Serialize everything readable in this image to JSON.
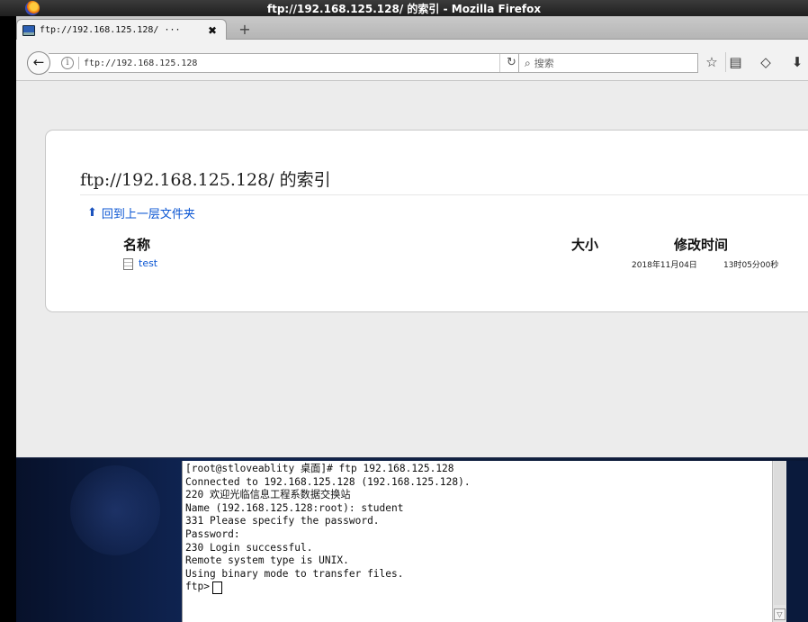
{
  "window": {
    "title": "ftp://192.168.125.128/ 的索引 - Mozilla Firefox"
  },
  "tab": {
    "title": "ftp://192.168.125.128/ ···",
    "close_glyph": "✖",
    "new_tab_glyph": "+"
  },
  "navbar": {
    "back_glyph": "←",
    "info_glyph": "i",
    "url": "ftp://192.168.125.128",
    "reload_glyph": "↻",
    "search_placeholder": "搜索",
    "search_glyph": "⌕",
    "bookmark_glyph": "☆",
    "bookmarks_menu_glyph": "▤",
    "pocket_glyph": "◇",
    "download_glyph": "⬇"
  },
  "listing": {
    "title": "ftp://192.168.125.128/ 的索引",
    "up_link": "回到上一层文件夹",
    "up_glyph": "⬆",
    "columns": {
      "name": "名称",
      "size": "大小",
      "mtime": "修改时间"
    },
    "files": [
      {
        "name": "test",
        "date": "2018年11月04日",
        "time": "13时05分00秒"
      }
    ]
  },
  "terminal": {
    "lines": [
      "[root@stloveablity 桌面]# ftp 192.168.125.128",
      "Connected to 192.168.125.128 (192.168.125.128).",
      "220 欢迎光临信息工程系数据交换站",
      "Name (192.168.125.128:root): student",
      "331 Please specify the password.",
      "Password:",
      "230 Login successful.",
      "Remote system type is UNIX.",
      "Using binary mode to transfer files."
    ],
    "prompt": "ftp>",
    "scroll_down_glyph": "▽"
  },
  "colors": {
    "link": "#0b56d3",
    "titlebar": "#2a2a2a",
    "page_bg": "#ececec"
  }
}
